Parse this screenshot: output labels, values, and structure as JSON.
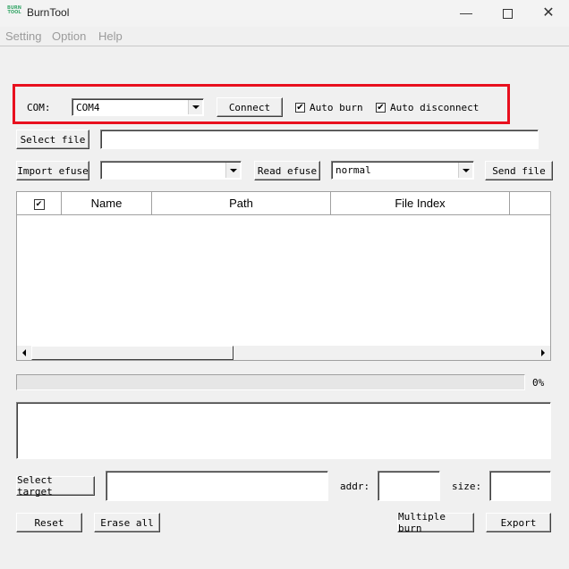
{
  "window": {
    "title": "BurnTool",
    "icon_text": "BURN\nTOOL"
  },
  "menu": [
    "Setting",
    "Option",
    "Help"
  ],
  "com": {
    "label": "COM:",
    "port": "COM4",
    "connect_label": "Connect",
    "auto_burn_label": "Auto burn",
    "auto_burn_checked": true,
    "auto_disconnect_label": "Auto disconnect",
    "auto_disconnect_checked": true
  },
  "file": {
    "select_label": "Select file",
    "path": ""
  },
  "efuse": {
    "import_label": "Import efuse",
    "import_value": "",
    "read_label": "Read efuse",
    "mode": "normal",
    "send_label": "Send file"
  },
  "table": {
    "columns": [
      "Name",
      "Path",
      "File Index"
    ],
    "rows": []
  },
  "progress": {
    "value": 0,
    "text": "0%"
  },
  "log": {
    "text": ""
  },
  "target": {
    "select_label": "Select target",
    "value": "",
    "addr_label": "addr:",
    "addr_value": "",
    "size_label": "size:",
    "size_value": ""
  },
  "actions": {
    "reset_label": "Reset",
    "erase_all_label": "Erase all",
    "multiple_burn_label": "Multiple burn",
    "export_label": "Export"
  }
}
